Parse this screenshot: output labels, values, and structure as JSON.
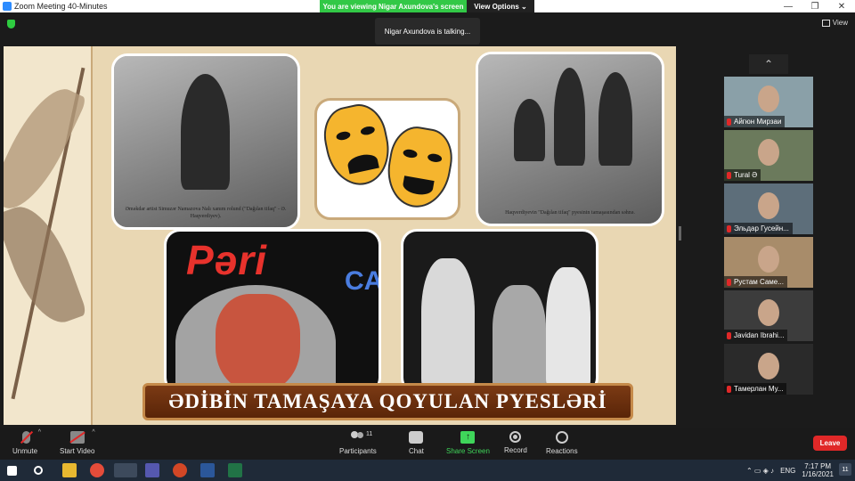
{
  "window": {
    "title": "Zoom Meeting 40-Minutes",
    "minimize": "—",
    "restore": "❐",
    "close": "✕"
  },
  "share_banner": {
    "message": "You are viewing Nigar Axundova's screen",
    "options": "View Options ⌄"
  },
  "talking": "Nigar Axundova is talking...",
  "view_button": "View",
  "slide": {
    "photo1_caption": "Əməkdar artist Simuzər Namazova Nalı xanım rolund (\"Dağılan tifaq\" - Ə. Haqverdiyev).",
    "photo2_caption": "Haqverdiyevin \"Dağılan tifaq\" pyesinin tamaşasından səhnə.",
    "pari_title": "Pəri",
    "pari_sub": "CADU",
    "banner": "ƏDİBİN TAMAŞAYA QOYULAN PYESLƏRİ"
  },
  "gallery_up": "⌃",
  "participants": [
    {
      "name": "Айгюн Мирзаи",
      "bg": "#8aa0a8"
    },
    {
      "name": "Tural Ə",
      "bg": "#6b7a5c"
    },
    {
      "name": "Эльдар Гусейн...",
      "bg": "#5d6e7a"
    },
    {
      "name": "Рустам Саме...",
      "bg": "#a88c6a"
    },
    {
      "name": "Javidan Ibrahi...",
      "bg": "#3c3c3c"
    },
    {
      "name": "Тамерлан Му...",
      "bg": "#2a2a2a"
    }
  ],
  "toolbar": {
    "unmute": "Unmute",
    "start_video": "Start Video",
    "participants": "Participants",
    "participants_count": "11",
    "chat": "Chat",
    "share_screen": "Share Screen",
    "record": "Record",
    "reactions": "Reactions",
    "leave": "Leave"
  },
  "taskbar": {
    "language": "ENG",
    "time": "7:17 PM",
    "date": "1/16/2021",
    "notifications": "11",
    "tray_icons": "⌃ ▭ ◈ ♪"
  },
  "colors": {
    "share_green": "#32c846",
    "leave_red": "#e02828",
    "banner_brown": "#6b2f0e"
  }
}
